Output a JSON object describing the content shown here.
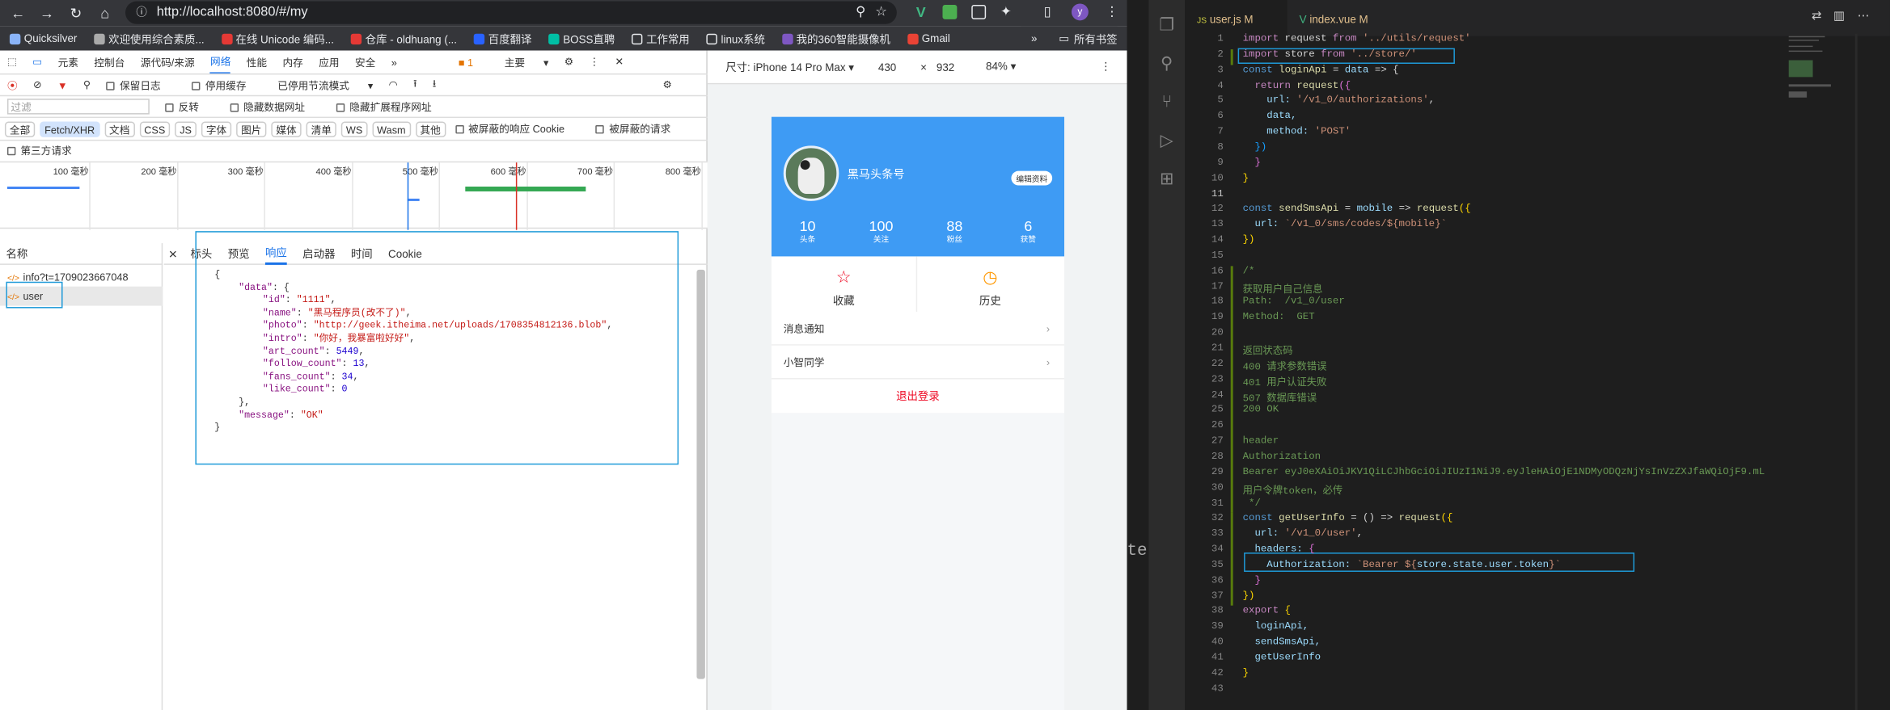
{
  "browser": {
    "url": "http://localhost:8080/#/my",
    "bookmarks": [
      "Quicksilver",
      "欢迎使用综合素质...",
      "在线 Unicode 编码...",
      "仓库 - oldhuang (...",
      "百度翻译",
      "BOSS直聘",
      "工作常用",
      "linux系统",
      "我的360智能摄像机",
      "Gmail"
    ],
    "bookmarks_more": "»",
    "all_bookmarks": "所有书签"
  },
  "devtools": {
    "tabs": [
      "元素",
      "控制台",
      "源代码/来源",
      "网络",
      "性能",
      "内存",
      "应用",
      "安全"
    ],
    "more_tabs": "»",
    "issues": "1",
    "context": "主要",
    "toolbar": {
      "preserve_log": "保留日志",
      "disable_cache": "停用缓存",
      "throttle": "已停用节流模式"
    },
    "filter_placeholder": "过滤",
    "invert": "反转",
    "hide_data_urls": "隐藏数据网址",
    "hide_ext_urls": "隐藏扩展程序网址",
    "types": [
      "全部",
      "Fetch/XHR",
      "文档",
      "CSS",
      "JS",
      "字体",
      "图片",
      "媒体",
      "清单",
      "WS",
      "Wasm",
      "其他"
    ],
    "blocked_cookies": "被屏蔽的响应 Cookie",
    "blocked_requests": "被屏蔽的请求",
    "third_party": "第三方请求",
    "ticks": [
      "100 毫秒",
      "200 毫秒",
      "300 毫秒",
      "400 毫秒",
      "500 毫秒",
      "600 毫秒",
      "700 毫秒",
      "800 毫秒"
    ],
    "name_header": "名称",
    "requests": [
      "info?t=1709023667048",
      "user"
    ],
    "detail_tabs": [
      "标头",
      "预览",
      "响应",
      "启动器",
      "时间",
      "Cookie"
    ],
    "close": "×",
    "response": {
      "data_key": "\"data\"",
      "id_key": "\"id\"",
      "id_val": "\"1111\"",
      "name_key": "\"name\"",
      "name_val": "\"黑马程序员(改不了)\"",
      "photo_key": "\"photo\"",
      "photo_val": "\"http://geek.itheima.net/uploads/1708354812136.blob\"",
      "intro_key": "\"intro\"",
      "intro_val": "\"你好，我暴富啦好好\"",
      "art_key": "\"art_count\"",
      "art_val": "5449",
      "follow_key": "\"follow_count\"",
      "follow_val": "13",
      "fans_key": "\"fans_count\"",
      "fans_val": "34",
      "like_key": "\"like_count\"",
      "like_val": "0",
      "message_key": "\"message\"",
      "message_val": "\"OK\""
    }
  },
  "device": {
    "label": "尺寸: iPhone 14 Pro Max",
    "width": "430",
    "x": "×",
    "height": "932",
    "zoom": "84%"
  },
  "phone": {
    "nickname": "黑马头条号",
    "edit": "编辑资料",
    "stats": [
      {
        "value": "10",
        "label": "头条"
      },
      {
        "value": "100",
        "label": "关注"
      },
      {
        "value": "88",
        "label": "粉丝"
      },
      {
        "value": "6",
        "label": "获赞"
      }
    ],
    "fav": "收藏",
    "history": "历史",
    "cells": [
      "消息通知",
      "小智同学"
    ],
    "logout": "退出登录"
  },
  "mid": {
    "text": "te"
  },
  "vscode": {
    "tabs": [
      {
        "icon": "JS",
        "name": "user.js",
        "mod": "M"
      },
      {
        "icon": "V",
        "name": "index.vue",
        "mod": "M"
      }
    ],
    "line_numbers": [
      "1",
      "2",
      "3",
      "4",
      "5",
      "6",
      "7",
      "8",
      "9",
      "10",
      "11",
      "12",
      "13",
      "14",
      "15",
      "16",
      "17",
      "18",
      "19",
      "20",
      "21",
      "22",
      "23",
      "24",
      "25",
      "26",
      "27",
      "28",
      "29",
      "30",
      "31",
      "32",
      "33",
      "34",
      "35",
      "36",
      "37",
      "38",
      "39",
      "40",
      "41",
      "42",
      "43"
    ],
    "code": {
      "l1a": "import",
      "l1b": " request ",
      "l1c": "from",
      "l1d": " '../utils/request'",
      "l2a": "import",
      "l2b": " store ",
      "l2c": "from",
      "l2d": " '../store/'",
      "l3a": "const",
      "l3b": " loginApi ",
      "l3c": "= ",
      "l3d": "data",
      "l3e": " => {",
      "l4a": "  return ",
      "l4b": "request",
      "l4c": "({",
      "l5a": "    url: ",
      "l5b": "'/v1_0/authorizations'",
      "l5c": ",",
      "l6": "    data,",
      "l7a": "    method: ",
      "l7b": "'POST'",
      "l8": "  })",
      "l9": "  }",
      "l10": "}",
      "l12a": "const",
      "l12b": " sendSmsApi ",
      "l12c": "= ",
      "l12d": "mobile",
      "l12e": " => ",
      "l12f": "request",
      "l12g": "({",
      "l13a": "  url: ",
      "l13b": "`/v1_0/sms/codes/${mobile}`",
      "l14": "})",
      "l16": "/*",
      "l17": "获取用户自己信息",
      "l18": "Path:  /v1_0/user",
      "l19": "Method:  GET",
      "l21": "返回状态码",
      "l22": "400 请求参数错误",
      "l23": "401 用户认证失败",
      "l24": "507 数据库错误",
      "l25": "200 OK",
      "l27": "header",
      "l28": "Authorization",
      "l29": "Bearer eyJ0eXAiOiJKV1QiLCJhbGciOiJIUzI1NiJ9.eyJleHAiOjE1NDMyODQzNjYsInVzZXJfaWQiOjF9.mL",
      "l30": "用户令牌token，必传",
      "l31": " */",
      "l32a": "const",
      "l32b": " getUserInfo ",
      "l32c": "= () => ",
      "l32d": "request",
      "l32e": "({",
      "l33a": "  url: ",
      "l33b": "'/v1_0/user'",
      "l33c": ",",
      "l34a": "  headers: ",
      "l34b": "{",
      "l35a": "    Authorization: ",
      "l35b": "`Bearer ${",
      "l35c": "store.state.user.token",
      "l35d": "}`",
      "l36": "  }",
      "l37": "})",
      "l38a": "export",
      "l38b": " {",
      "l39": "  loginApi,",
      "l40": "  sendSmsApi,",
      "l41": "  getUserInfo",
      "l42": "}"
    }
  }
}
